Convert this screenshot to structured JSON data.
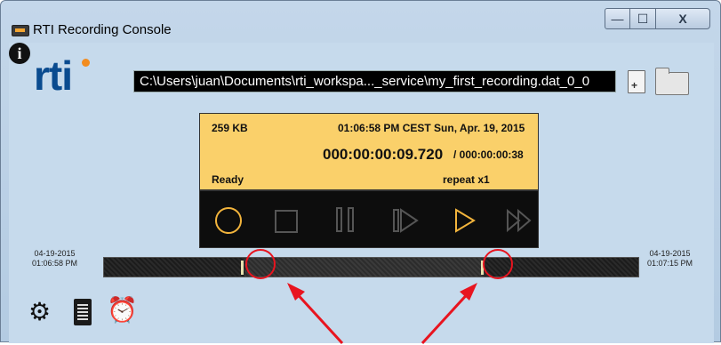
{
  "window": {
    "title": "RTI Recording Console",
    "minimize_glyph": "—",
    "maximize_glyph": "☐",
    "close_glyph": "X"
  },
  "header": {
    "logo_text": "rti",
    "file_path": "C:\\Users\\juan\\Documents\\rti_workspa..._service\\my_first_recording.dat_0_0",
    "new_file_icon": "new-file-icon",
    "open_folder_icon": "folder-icon"
  },
  "status": {
    "size": "259 KB",
    "datetime": "01:06:58 PM CEST  Sun, Apr. 19, 2015",
    "elapsed": "000:00:00:09.720",
    "total": "/ 000:00:00:38",
    "state": "Ready",
    "repeat": "repeat   x1"
  },
  "controls": {
    "icons": [
      "record-icon",
      "stop-icon",
      "pause-icon",
      "step-icon",
      "play-icon",
      "fast-forward-icon"
    ]
  },
  "timeline": {
    "start_date": "04-19-2015",
    "start_time": "01:06:58 PM",
    "end_date": "04-19-2015",
    "end_time": "01:07:15 PM"
  },
  "footer": {
    "icons": [
      "settings-gears-icon",
      "log-icon",
      "alarm-clock-icon",
      "info-icon"
    ],
    "info_glyph": "i"
  },
  "colors": {
    "background": "#c6daec",
    "status_panel": "#fad06a",
    "controls_bg": "#0d0d0d",
    "accent_orange": "#f2b43c",
    "logo_blue": "#0a4b8f",
    "annotation_red": "#e8141f"
  }
}
